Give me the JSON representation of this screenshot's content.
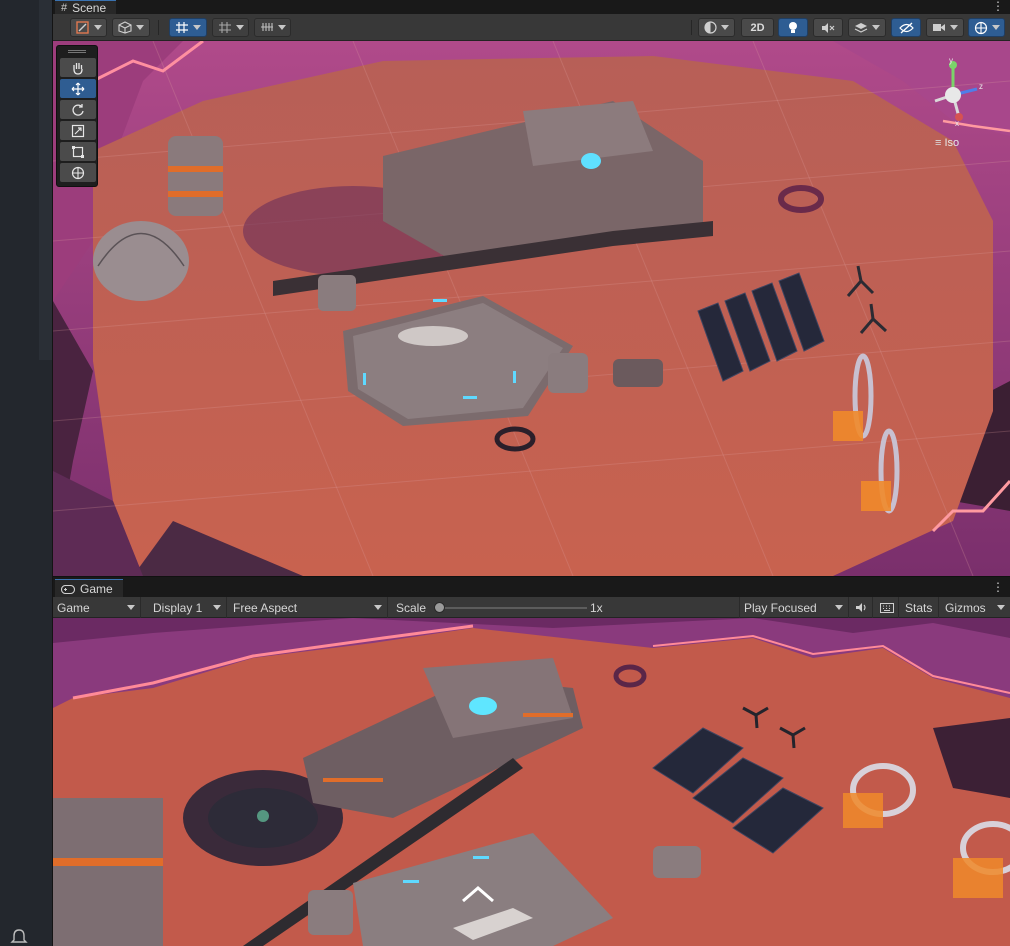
{
  "scene": {
    "tab_title": "Scene",
    "toolbar": {
      "toggle_2d": "2D"
    },
    "camera_view_label": "Iso",
    "gizmo_axes": {
      "x": "x",
      "y": "y",
      "z": "z"
    }
  },
  "game": {
    "tab_title": "Game",
    "toolbar": {
      "view_mode": "Game",
      "display": "Display 1",
      "aspect": "Free Aspect",
      "scale_label": "Scale",
      "scale_value": "1x",
      "play_mode": "Play Focused",
      "stats": "Stats",
      "gizmos": "Gizmos"
    }
  },
  "colors": {
    "accent": "#2e5d93",
    "terrain": "#c4604f",
    "cliffs": "#8a2f78"
  }
}
